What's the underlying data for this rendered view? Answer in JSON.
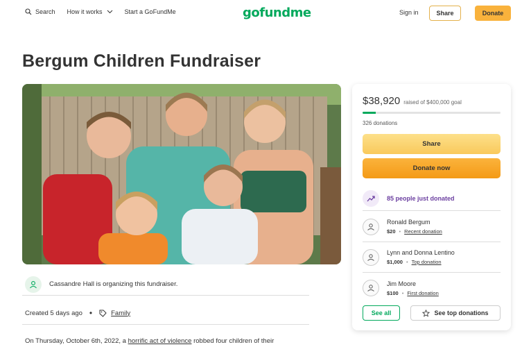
{
  "header": {
    "search_label": "Search",
    "how_it_works_label": "How it works",
    "start_label": "Start a GoFundMe",
    "logo_text": "gofundme",
    "signin_label": "Sign in",
    "share_label": "Share",
    "donate_label": "Donate"
  },
  "campaign": {
    "title": "Bergum Children Fundraiser",
    "organizer_text": "Cassandre Hall is organizing this fundraiser.",
    "created": "Created 5 days ago",
    "category": "Family",
    "story_before": "On Thursday, October 6th, 2022, a ",
    "story_link": "horrific act of violence",
    "story_after": " robbed four children of their"
  },
  "donation_card": {
    "raised": "$38,920",
    "goal_text": "raised of $400,000 goal",
    "progress_fraction": 0.0973,
    "donation_count": "326 donations",
    "share_label": "Share",
    "donate_label": "Donate now",
    "trending_text": "85 people just donated",
    "donors": [
      {
        "name": "Ronald Bergum",
        "amount": "$20",
        "type": "Recent donation"
      },
      {
        "name": "Lynn and Donna Lentino",
        "amount": "$1,000",
        "type": "Top donation"
      },
      {
        "name": "Jim Moore",
        "amount": "$100",
        "type": "First donation"
      }
    ],
    "see_all_label": "See all",
    "see_top_label": "See top donations"
  },
  "colors": {
    "brand_green": "#02a95c",
    "donate_orange": "#f9b23c",
    "trending_purple": "#6b3fa0"
  }
}
